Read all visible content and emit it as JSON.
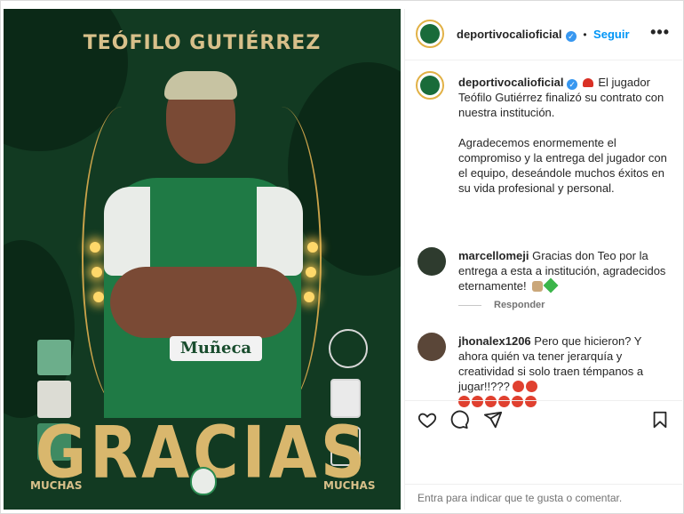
{
  "media": {
    "player_name": "TEÓFILO GUTIÉRREZ",
    "headline": "GRACIAS",
    "muchas_left": "MUCHAS",
    "muchas_right": "MUCHAS",
    "jersey_sponsor": "Muñeca",
    "colors": {
      "background": "#123a22",
      "gold": "#d9b76d",
      "jersey": "#1f7a45"
    }
  },
  "header": {
    "username": "deportivocalioficial",
    "separator": "•",
    "follow_label": "Seguir",
    "more_icon": "more-horizontal-icon"
  },
  "caption": {
    "username": "deportivocalioficial",
    "text_1": "El jugador Teófilo Gutiérrez finalizó su contrato con nuestra institución.",
    "text_2": "Agradecemos enormemente el compromiso y la entrega del jugador con el equipo, deseándole muchos éxitos en su vida profesional y personal."
  },
  "comments": [
    {
      "username": "marcellomeji",
      "text": "Gracias don Teo por la entrega a esta a institución, agradecidos eternamente!",
      "reply_label": "Responder"
    },
    {
      "username": "jhonalex1206",
      "text": "Pero que hicieron? Y ahora quién va tener jerarquía y creatividad si solo traen témpanos a jugar!!???"
    }
  ],
  "actions": {
    "like_icon": "heart-icon",
    "comment_icon": "comment-icon",
    "share_icon": "send-icon",
    "save_icon": "bookmark-icon"
  },
  "add_comment": {
    "enter_key": "Entra",
    "placeholder": "para indicar que te gusta o comentar."
  }
}
